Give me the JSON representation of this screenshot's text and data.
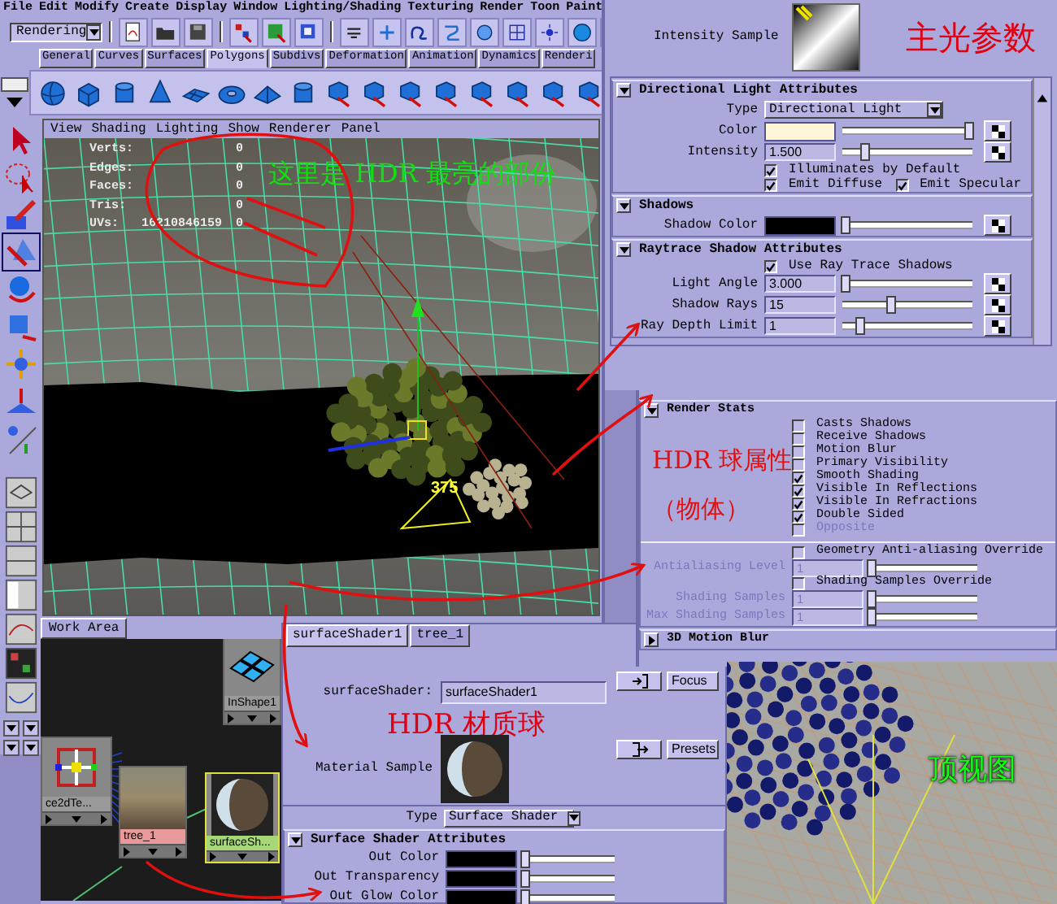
{
  "menu_bar": [
    "File",
    "Edit",
    "Modify",
    "Create",
    "Display",
    "Window",
    "Lighting/Shading",
    "Texturing",
    "Render",
    "Toon",
    "Paint"
  ],
  "status_line": {
    "menu_set": "Rendering"
  },
  "shelf_tabs": [
    {
      "label": "General",
      "selected": false
    },
    {
      "label": "Curves",
      "selected": false
    },
    {
      "label": "Surfaces",
      "selected": false
    },
    {
      "label": "Polygons",
      "selected": true
    },
    {
      "label": "Subdivs",
      "selected": false
    },
    {
      "label": "Deformation",
      "selected": false
    },
    {
      "label": "Animation",
      "selected": false
    },
    {
      "label": "Dynamics",
      "selected": false
    },
    {
      "label": "Renderi",
      "selected": false
    }
  ],
  "viewport": {
    "panel_menu": [
      "View",
      "Shading",
      "Lighting",
      "Show",
      "Renderer",
      "Panel"
    ],
    "stats": [
      {
        "label": "Verts:",
        "count": "0"
      },
      {
        "label": "Edges:",
        "count": "0"
      },
      {
        "label": "Faces:",
        "count": "0"
      },
      {
        "label": "Tris:",
        "count": "0"
      },
      {
        "label": "UVs:",
        "value": "16210846159",
        "count": "0"
      }
    ],
    "note": "这里是 HDR 最亮的部份",
    "measure": "375"
  },
  "light_editor": {
    "sample_label": "Intensity Sample",
    "note": "主光参数",
    "sections": [
      {
        "title": "Directional Light Attributes",
        "expanded": true,
        "rows": [
          {
            "kind": "dropdown",
            "label": "Type",
            "value": "Directional Light"
          },
          {
            "kind": "color",
            "label": "Color",
            "color": "#fff6d8",
            "level": 0.97
          },
          {
            "kind": "number",
            "label": "Intensity",
            "value": "1.500",
            "level": 0.17,
            "disabled": false
          },
          {
            "kind": "check",
            "label": "Illuminates by Default",
            "checked": true,
            "disabled": false
          },
          {
            "kind": "check_pair",
            "items": [
              {
                "label": "Emit Diffuse",
                "checked": true,
                "disabled": false
              },
              {
                "label": "Emit Specular",
                "checked": true,
                "disabled": false
              }
            ]
          }
        ]
      },
      {
        "title": "Shadows",
        "expanded": true,
        "rows": [
          {
            "kind": "color",
            "label": "Shadow Color",
            "color": "#000000",
            "level": 0.02
          }
        ]
      },
      {
        "title": "Raytrace Shadow Attributes",
        "expanded": true,
        "rows": [
          {
            "kind": "check",
            "label": "Use Ray Trace Shadows",
            "checked": true,
            "disabled": false
          },
          {
            "kind": "number",
            "label": "Light Angle",
            "value": "3.000",
            "level": 0.03,
            "disabled": false
          },
          {
            "kind": "number",
            "label": "Shadow Rays",
            "value": "15",
            "level": 0.38,
            "disabled": false
          },
          {
            "kind": "number",
            "label": "Ray Depth Limit",
            "value": "1",
            "level": 0.14,
            "disabled": false
          }
        ]
      }
    ]
  },
  "render_stats": {
    "note": "HDR 球属性",
    "note_2": "（物体）",
    "sections": [
      {
        "title": "Render Stats",
        "expanded": true,
        "rows": [
          {
            "kind": "check",
            "label": "Casts Shadows",
            "checked": false,
            "disabled": false
          },
          {
            "kind": "check",
            "label": "Receive Shadows",
            "checked": false,
            "disabled": false
          },
          {
            "kind": "check",
            "label": "Motion Blur",
            "checked": false,
            "disabled": false
          },
          {
            "kind": "check",
            "label": "Primary Visibility",
            "checked": false,
            "disabled": false
          },
          {
            "kind": "check",
            "label": "Smooth Shading",
            "checked": true,
            "disabled": false
          },
          {
            "kind": "check",
            "label": "Visible In Reflections",
            "checked": true,
            "disabled": false
          },
          {
            "kind": "check",
            "label": "Visible In Refractions",
            "checked": true,
            "disabled": false
          },
          {
            "kind": "check",
            "label": "Double Sided",
            "checked": true,
            "disabled": false
          },
          {
            "kind": "check",
            "label": "Opposite",
            "checked": false,
            "disabled": true
          },
          {
            "kind": "divider"
          },
          {
            "kind": "check",
            "label": "Geometry Anti-aliasing Override",
            "checked": false,
            "disabled": false
          },
          {
            "kind": "number",
            "label": "Antialiasing Level",
            "value": "1",
            "level": 0.01,
            "disabled": true
          },
          {
            "kind": "check",
            "label": "Shading Samples Override",
            "checked": false,
            "disabled": false
          },
          {
            "kind": "number",
            "label": "Shading Samples",
            "value": "1",
            "level": 0.01,
            "disabled": true
          },
          {
            "kind": "number",
            "label": "Max Shading Samples",
            "value": "1",
            "level": 0.01,
            "disabled": true
          }
        ]
      },
      {
        "title": "3D Motion Blur",
        "expanded": false
      }
    ]
  },
  "work_area": {
    "tab": "Work Area",
    "nodes": [
      {
        "kind": "place2d",
        "label": "ce2dTe..."
      },
      {
        "kind": "shape",
        "label": "InShape1"
      },
      {
        "kind": "texture",
        "label": "tree_1"
      },
      {
        "kind": "shader",
        "label": "surfaceSh..."
      }
    ]
  },
  "shader_editor": {
    "tabs": [
      {
        "label": "surfaceShader1",
        "selected": true
      },
      {
        "label": "tree_1",
        "selected": false
      }
    ],
    "name_label": "surfaceShader:",
    "name_value": "surfaceShader1",
    "buttons": [
      "Focus",
      "Presets"
    ],
    "note": "HDR 材质球",
    "sample_label": "Material Sample",
    "rows": [
      {
        "kind": "dropdown",
        "label": "Type",
        "value": "Surface Shader"
      }
    ],
    "sections": [
      {
        "title": "Surface Shader Attributes",
        "expanded": true,
        "rows": [
          {
            "kind": "color",
            "label": "Out Color",
            "color": "#000000",
            "level": 0.02
          },
          {
            "kind": "color",
            "label": "Out Transparency",
            "color": "#000000",
            "level": 0.02
          },
          {
            "kind": "color",
            "label": "Out Glow Color",
            "color": "#000000",
            "level": 0.02
          }
        ]
      }
    ]
  },
  "top_view": {
    "note": "顶视图"
  }
}
